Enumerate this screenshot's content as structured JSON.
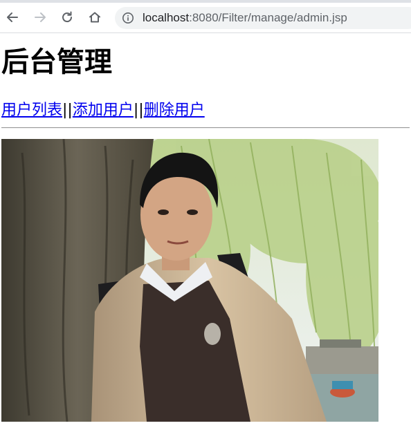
{
  "browser": {
    "url_host": "localhost",
    "url_path": ":8080/Filter/manage/admin.jsp",
    "icons": {
      "back": "arrow-left-icon",
      "forward": "arrow-right-icon",
      "reload": "reload-icon",
      "home": "home-icon",
      "info": "info-icon"
    }
  },
  "page": {
    "title": "后台管理",
    "links": [
      {
        "label": "用户列表"
      },
      {
        "label": "添加用户"
      },
      {
        "label": "删除用户"
      }
    ],
    "separator": "||"
  },
  "photo": {
    "subject": "portrait photo of a man in front of a tree and willow branches"
  }
}
